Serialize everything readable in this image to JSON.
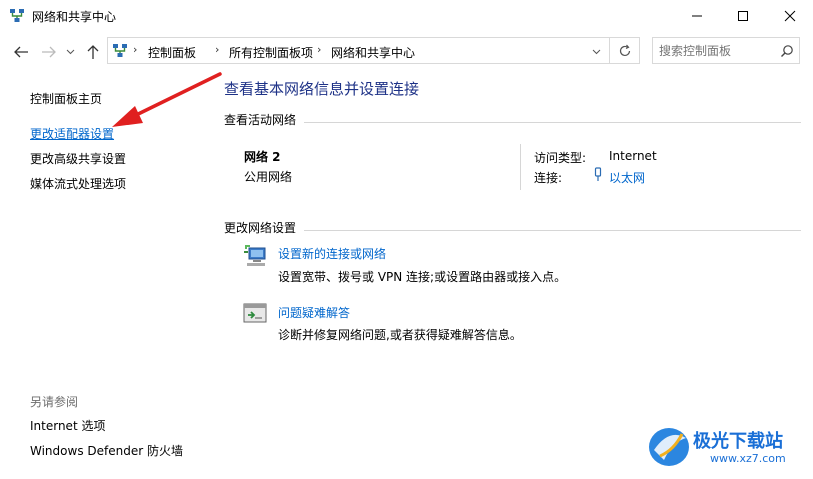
{
  "window": {
    "title": "网络和共享中心",
    "icon": "network-icon",
    "controls": {
      "minimize": "minimize-icon",
      "maximize": "maximize-icon",
      "close": "close-icon"
    }
  },
  "navigation": {
    "back": "back-arrow-icon",
    "forward": "forward-arrow-icon",
    "recent": "chevron-down-icon",
    "up": "up-arrow-icon",
    "breadcrumb": [
      "控制面板",
      "所有控制面板项",
      "网络和共享中心"
    ],
    "refresh": "refresh-icon",
    "search_placeholder": "搜索控制面板",
    "search_icon": "search-icon"
  },
  "sidebar": {
    "items": [
      {
        "label": "控制面板主页"
      },
      {
        "label": "更改适配器设置"
      },
      {
        "label": "更改高级共享设置"
      },
      {
        "label": "媒体流式处理选项"
      }
    ],
    "see_also": {
      "heading": "另请参阅",
      "items": [
        {
          "label": "Internet 选项"
        },
        {
          "label": "Windows Defender 防火墙"
        }
      ]
    }
  },
  "main": {
    "heading": "查看基本网络信息并设置连接",
    "active_networks": {
      "label": "查看活动网络",
      "network_name": "网络 2",
      "network_type": "公用网络",
      "access_type_label": "访问类型:",
      "access_type_value": "Internet",
      "connection_label": "连接:",
      "connection_value": "以太网"
    },
    "change_settings": {
      "label": "更改网络设置",
      "items": [
        {
          "link": "设置新的连接或网络",
          "description": "设置宽带、拨号或 VPN 连接;或设置路由器或接入点。",
          "icon": "new-connection-icon"
        },
        {
          "link": "问题疑难解答",
          "description": "诊断并修复网络问题,或者获得疑难解答信息。",
          "icon": "troubleshoot-icon"
        }
      ]
    }
  },
  "watermark": {
    "name": "极光下载站",
    "url": "www.xz7.com"
  },
  "accent_colors": {
    "link": "#0066cc",
    "heading": "#1e3287",
    "annotation_arrow": "#e02020"
  }
}
